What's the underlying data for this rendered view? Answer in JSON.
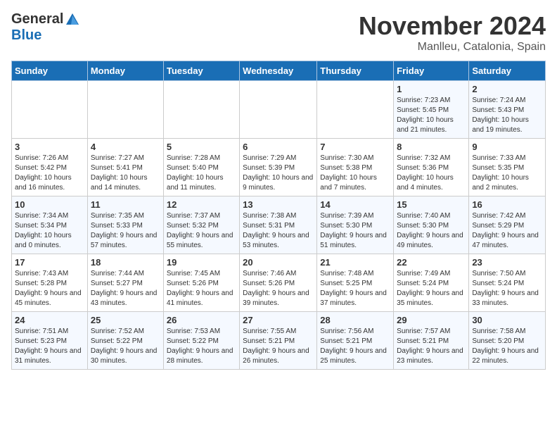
{
  "logo": {
    "general": "General",
    "blue": "Blue"
  },
  "title": "November 2024",
  "location": "Manlleu, Catalonia, Spain",
  "weekdays": [
    "Sunday",
    "Monday",
    "Tuesday",
    "Wednesday",
    "Thursday",
    "Friday",
    "Saturday"
  ],
  "weeks": [
    [
      {
        "day": "",
        "info": ""
      },
      {
        "day": "",
        "info": ""
      },
      {
        "day": "",
        "info": ""
      },
      {
        "day": "",
        "info": ""
      },
      {
        "day": "",
        "info": ""
      },
      {
        "day": "1",
        "info": "Sunrise: 7:23 AM\nSunset: 5:45 PM\nDaylight: 10 hours and 21 minutes."
      },
      {
        "day": "2",
        "info": "Sunrise: 7:24 AM\nSunset: 5:43 PM\nDaylight: 10 hours and 19 minutes."
      }
    ],
    [
      {
        "day": "3",
        "info": "Sunrise: 7:26 AM\nSunset: 5:42 PM\nDaylight: 10 hours and 16 minutes."
      },
      {
        "day": "4",
        "info": "Sunrise: 7:27 AM\nSunset: 5:41 PM\nDaylight: 10 hours and 14 minutes."
      },
      {
        "day": "5",
        "info": "Sunrise: 7:28 AM\nSunset: 5:40 PM\nDaylight: 10 hours and 11 minutes."
      },
      {
        "day": "6",
        "info": "Sunrise: 7:29 AM\nSunset: 5:39 PM\nDaylight: 10 hours and 9 minutes."
      },
      {
        "day": "7",
        "info": "Sunrise: 7:30 AM\nSunset: 5:38 PM\nDaylight: 10 hours and 7 minutes."
      },
      {
        "day": "8",
        "info": "Sunrise: 7:32 AM\nSunset: 5:36 PM\nDaylight: 10 hours and 4 minutes."
      },
      {
        "day": "9",
        "info": "Sunrise: 7:33 AM\nSunset: 5:35 PM\nDaylight: 10 hours and 2 minutes."
      }
    ],
    [
      {
        "day": "10",
        "info": "Sunrise: 7:34 AM\nSunset: 5:34 PM\nDaylight: 10 hours and 0 minutes."
      },
      {
        "day": "11",
        "info": "Sunrise: 7:35 AM\nSunset: 5:33 PM\nDaylight: 9 hours and 57 minutes."
      },
      {
        "day": "12",
        "info": "Sunrise: 7:37 AM\nSunset: 5:32 PM\nDaylight: 9 hours and 55 minutes."
      },
      {
        "day": "13",
        "info": "Sunrise: 7:38 AM\nSunset: 5:31 PM\nDaylight: 9 hours and 53 minutes."
      },
      {
        "day": "14",
        "info": "Sunrise: 7:39 AM\nSunset: 5:30 PM\nDaylight: 9 hours and 51 minutes."
      },
      {
        "day": "15",
        "info": "Sunrise: 7:40 AM\nSunset: 5:30 PM\nDaylight: 9 hours and 49 minutes."
      },
      {
        "day": "16",
        "info": "Sunrise: 7:42 AM\nSunset: 5:29 PM\nDaylight: 9 hours and 47 minutes."
      }
    ],
    [
      {
        "day": "17",
        "info": "Sunrise: 7:43 AM\nSunset: 5:28 PM\nDaylight: 9 hours and 45 minutes."
      },
      {
        "day": "18",
        "info": "Sunrise: 7:44 AM\nSunset: 5:27 PM\nDaylight: 9 hours and 43 minutes."
      },
      {
        "day": "19",
        "info": "Sunrise: 7:45 AM\nSunset: 5:26 PM\nDaylight: 9 hours and 41 minutes."
      },
      {
        "day": "20",
        "info": "Sunrise: 7:46 AM\nSunset: 5:26 PM\nDaylight: 9 hours and 39 minutes."
      },
      {
        "day": "21",
        "info": "Sunrise: 7:48 AM\nSunset: 5:25 PM\nDaylight: 9 hours and 37 minutes."
      },
      {
        "day": "22",
        "info": "Sunrise: 7:49 AM\nSunset: 5:24 PM\nDaylight: 9 hours and 35 minutes."
      },
      {
        "day": "23",
        "info": "Sunrise: 7:50 AM\nSunset: 5:24 PM\nDaylight: 9 hours and 33 minutes."
      }
    ],
    [
      {
        "day": "24",
        "info": "Sunrise: 7:51 AM\nSunset: 5:23 PM\nDaylight: 9 hours and 31 minutes."
      },
      {
        "day": "25",
        "info": "Sunrise: 7:52 AM\nSunset: 5:22 PM\nDaylight: 9 hours and 30 minutes."
      },
      {
        "day": "26",
        "info": "Sunrise: 7:53 AM\nSunset: 5:22 PM\nDaylight: 9 hours and 28 minutes."
      },
      {
        "day": "27",
        "info": "Sunrise: 7:55 AM\nSunset: 5:21 PM\nDaylight: 9 hours and 26 minutes."
      },
      {
        "day": "28",
        "info": "Sunrise: 7:56 AM\nSunset: 5:21 PM\nDaylight: 9 hours and 25 minutes."
      },
      {
        "day": "29",
        "info": "Sunrise: 7:57 AM\nSunset: 5:21 PM\nDaylight: 9 hours and 23 minutes."
      },
      {
        "day": "30",
        "info": "Sunrise: 7:58 AM\nSunset: 5:20 PM\nDaylight: 9 hours and 22 minutes."
      }
    ]
  ]
}
